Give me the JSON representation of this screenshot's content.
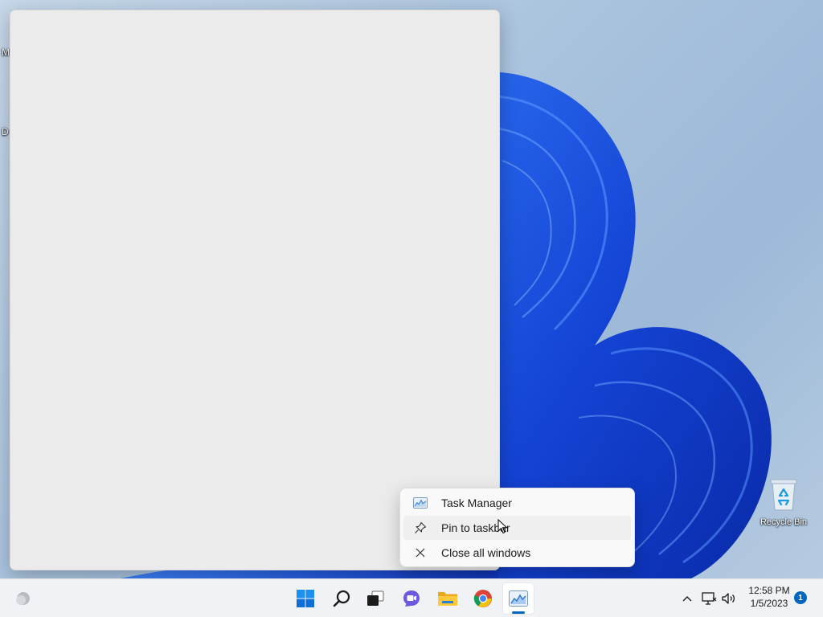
{
  "desktop": {
    "edge_labels": [
      "M",
      "D"
    ],
    "recycle_bin_label": "Recycle Bin"
  },
  "jump_list": {
    "items": [
      {
        "label": "Task Manager",
        "icon": "task-manager-icon"
      },
      {
        "label": "Pin to taskbar",
        "icon": "pin-icon"
      },
      {
        "label": "Close all windows",
        "icon": "close-icon"
      }
    ]
  },
  "taskbar": {
    "items": [
      "weather-icon",
      "start-icon",
      "search-icon",
      "task-view-icon",
      "chat-icon",
      "file-explorer-icon",
      "chrome-icon",
      "task-manager-icon"
    ],
    "active_item": "task-manager-icon"
  },
  "tray": {
    "time": "12:58 PM",
    "date": "1/5/2023",
    "notification_count": "1"
  },
  "colors": {
    "accent": "#0067c0",
    "bloom_blue": "#1f4fe0"
  }
}
